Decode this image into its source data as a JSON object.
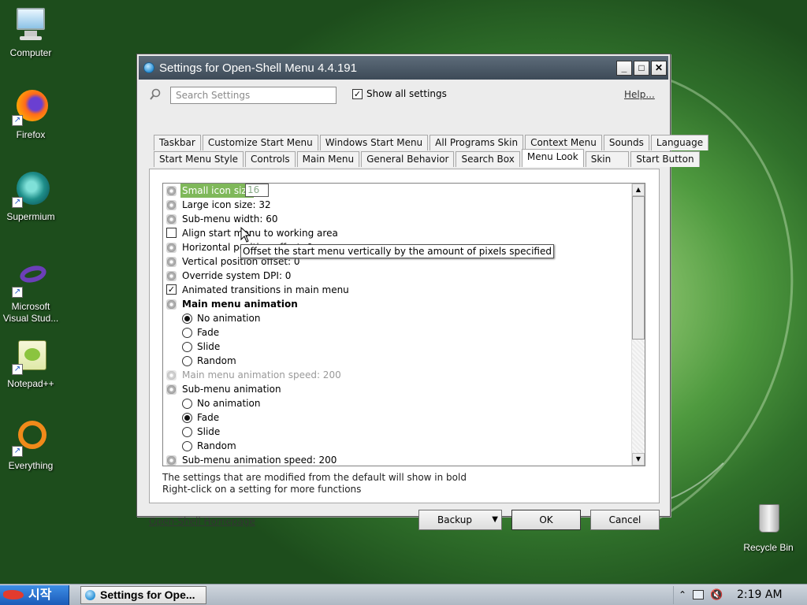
{
  "desktop": {
    "icons": [
      {
        "label": "Computer"
      },
      {
        "label": "Firefox"
      },
      {
        "label": "Supermium"
      },
      {
        "label": "Microsoft Visual Stud..."
      },
      {
        "label": "Notepad++"
      },
      {
        "label": "Everything"
      },
      {
        "label": "Recycle Bin"
      }
    ]
  },
  "window": {
    "title": "Settings for Open-Shell Menu 4.4.191",
    "minimize": "_",
    "maximize": "□",
    "close": "✕"
  },
  "search": {
    "placeholder": "Search Settings"
  },
  "show_all": {
    "label": "Show all settings",
    "checked": true
  },
  "help_link": "Help...",
  "tabs_row1": [
    "Taskbar",
    "Customize Start Menu",
    "Windows Start Menu",
    "All Programs Skin",
    "Context Menu",
    "Sounds",
    "Language"
  ],
  "tabs_row2": [
    "Start Menu Style",
    "Controls",
    "Main Menu",
    "General Behavior",
    "Search Box",
    "Menu Look",
    "Skin",
    "Start Button"
  ],
  "active_tab": "Menu Look",
  "settings": {
    "small_icon_label": "Small icon size",
    "small_icon_value": "16",
    "items": [
      {
        "text": "Large icon size: 32"
      },
      {
        "text": "Sub-menu width: 60"
      },
      {
        "text": "Align start menu to working area"
      },
      {
        "text": "Horizontal position offset: 0"
      },
      {
        "text": "Vertical position offset: 0"
      },
      {
        "text": "Override system DPI: 0"
      },
      {
        "text": "Animated transitions in main menu"
      },
      {
        "text": "Main menu animation"
      },
      {
        "text": "No animation"
      },
      {
        "text": "Fade"
      },
      {
        "text": "Slide"
      },
      {
        "text": "Random"
      },
      {
        "text": "Main menu animation speed: 200"
      },
      {
        "text": "Sub-menu animation"
      },
      {
        "text": "No animation"
      },
      {
        "text": "Fade"
      },
      {
        "text": "Slide"
      },
      {
        "text": "Random"
      },
      {
        "text": "Sub-menu animation speed: 200"
      }
    ]
  },
  "tooltip": "Offset the start menu vertically by the amount of pixels specified",
  "notes": {
    "line1": "The settings that are modified from the default will show in bold",
    "line2": "Right-click on a setting for more functions"
  },
  "homepage_link": "Open-Shell Homepage",
  "buttons": {
    "backup": "Backup",
    "ok": "OK",
    "cancel": "Cancel"
  },
  "taskbar": {
    "start_label": "시작",
    "task_label": "Settings for Ope...",
    "clock": "2:19 AM"
  }
}
